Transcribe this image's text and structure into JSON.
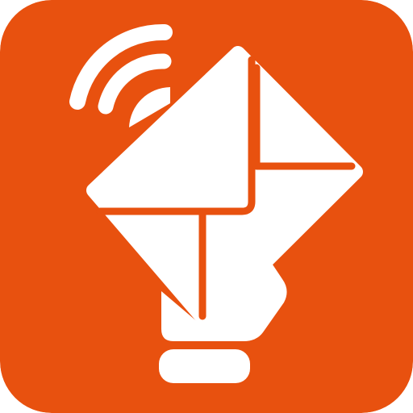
{
  "icon": {
    "name": "mail-delivery-app-icon",
    "symbol": "hand-holding-envelope-with-wireless-signal",
    "colors": {
      "background": "#E8510F",
      "foreground": "#FFFFFF"
    }
  }
}
